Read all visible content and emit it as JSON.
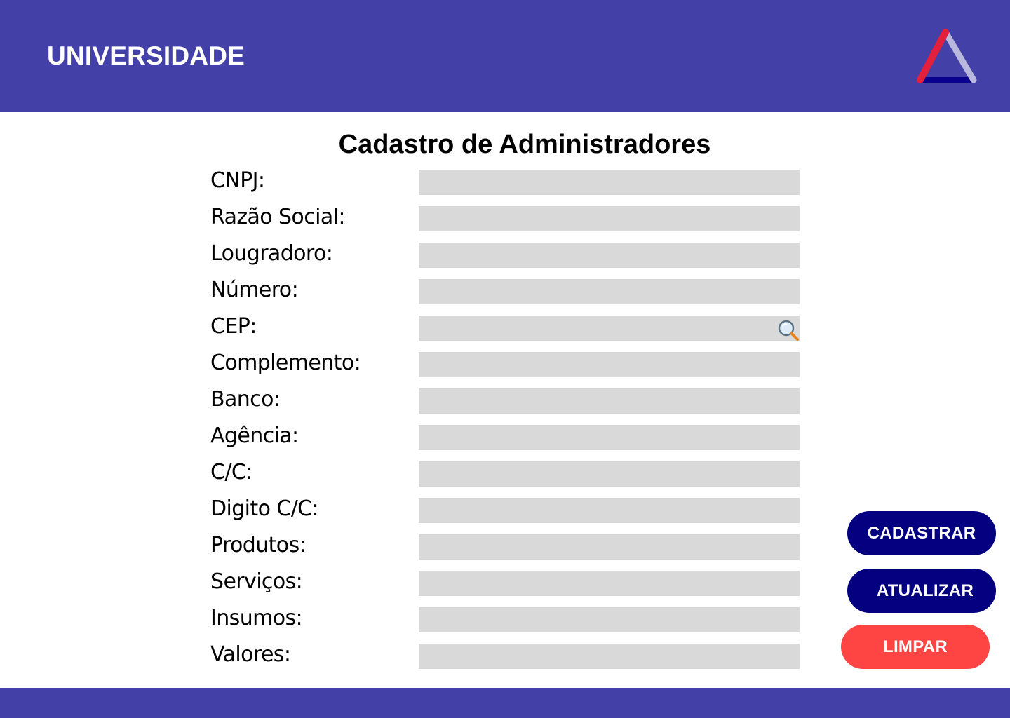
{
  "header": {
    "brand": "UNIVERSIDADE",
    "logo_icon": "triangle-logo-icon",
    "color": "#4340A8"
  },
  "page": {
    "title": "Cadastro de Administradores"
  },
  "form": {
    "fields": [
      {
        "label": "CNPJ:",
        "value": ""
      },
      {
        "label": "Razão Social:",
        "value": ""
      },
      {
        "label": "Lougradoro:",
        "value": ""
      },
      {
        "label": "Número:",
        "value": ""
      },
      {
        "label": "CEP:",
        "value": ""
      },
      {
        "label": "Complemento:",
        "value": ""
      },
      {
        "label": "Banco:",
        "value": ""
      },
      {
        "label": "Agência:",
        "value": ""
      },
      {
        "label": "C/C:",
        "value": ""
      },
      {
        "label": "Digito C/C:",
        "value": ""
      },
      {
        "label": "Produtos:",
        "value": ""
      },
      {
        "label": "Serviços:",
        "value": ""
      },
      {
        "label": "Insumos:",
        "value": ""
      },
      {
        "label": "Valores:",
        "value": ""
      }
    ],
    "search_icon": "search-icon",
    "input_color": "#D9D9D9"
  },
  "actions": {
    "cadastrar": "CADASTRAR",
    "atualizar": "ATUALIZAR",
    "limpar": "LIMPAR",
    "primary_color": "#040080",
    "danger_color": "#FF4444"
  }
}
